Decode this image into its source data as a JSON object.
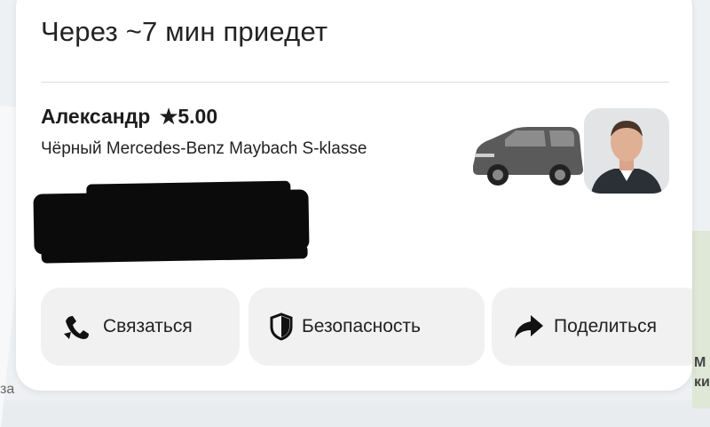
{
  "map": {
    "left_label": "за",
    "right_label_1": "М",
    "right_label_2": "ки"
  },
  "card": {
    "eta_title": "Через ~7 мин приедет",
    "driver": {
      "name": "Александр",
      "rating_star": "★",
      "rating": "5.00",
      "car_description": "Чёрный Mercedes-Benz Maybach S-klasse"
    },
    "actions": [
      {
        "label": "Связаться",
        "icon": "phone-icon"
      },
      {
        "label": "Безопасность",
        "icon": "shield-icon"
      },
      {
        "label": "Поделиться",
        "icon": "share-arrow-icon"
      }
    ]
  },
  "colors": {
    "card_bg": "#ffffff",
    "button_bg": "#f1f1f1",
    "text": "#222222",
    "map_bg": "#eef1f3"
  }
}
